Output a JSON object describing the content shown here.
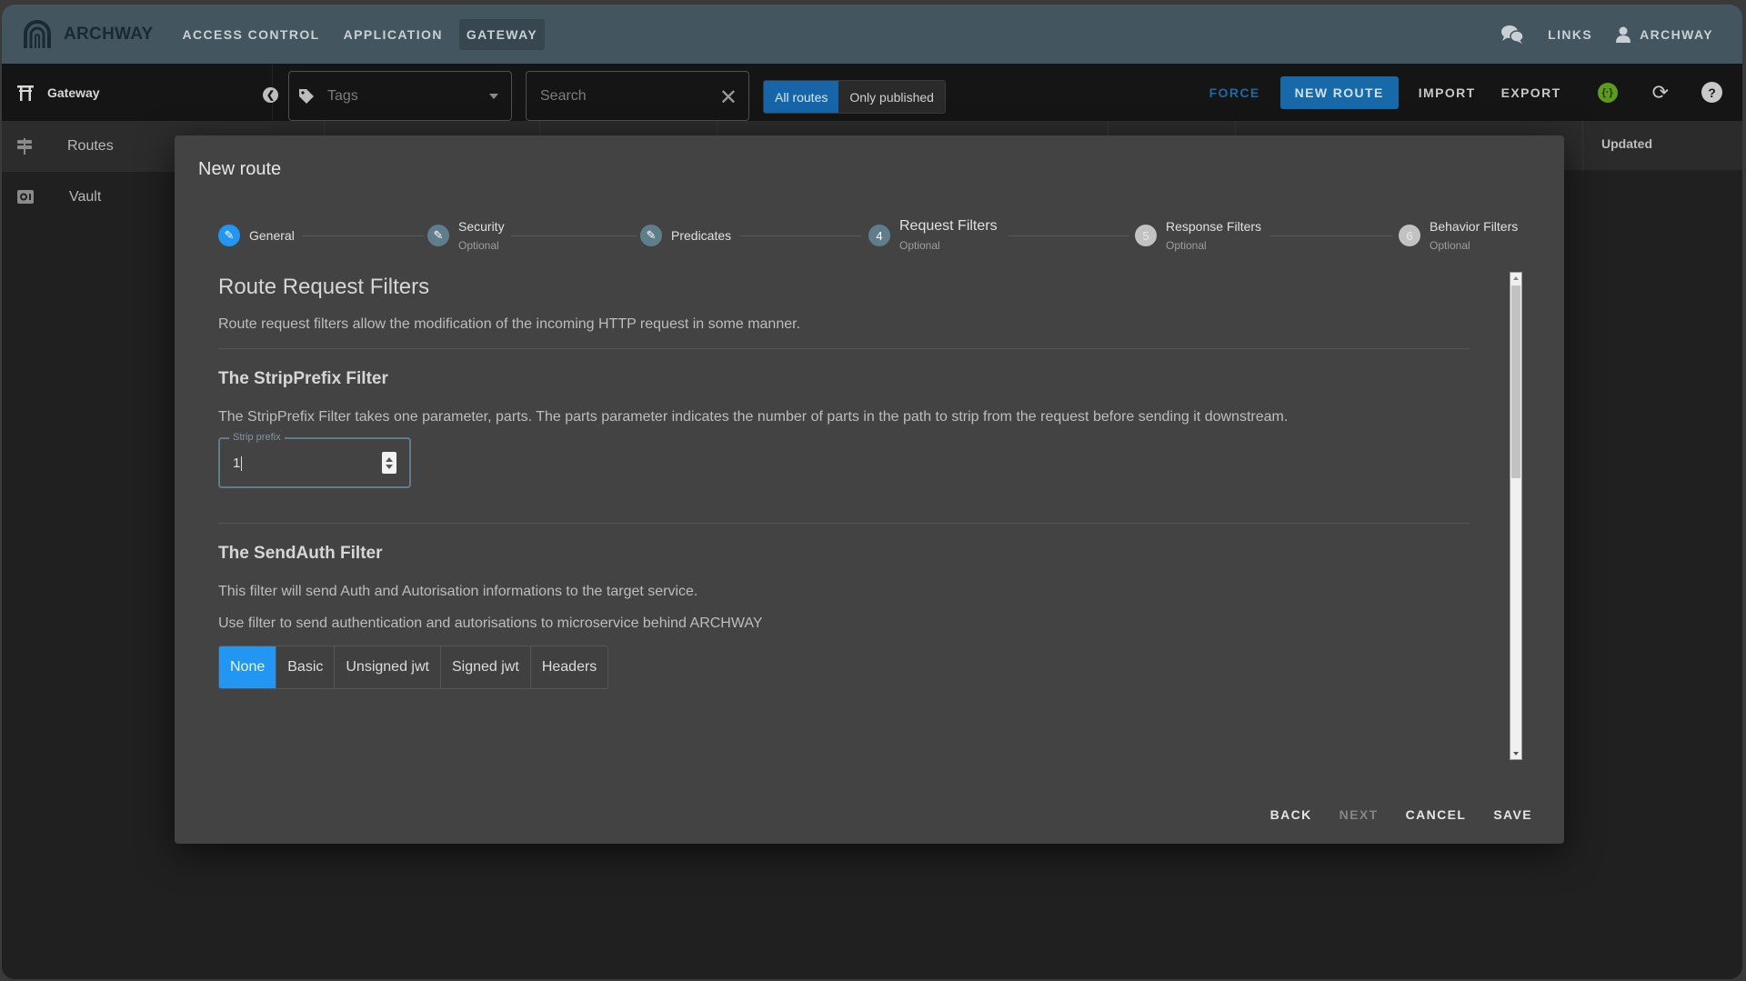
{
  "app": {
    "name": "ARCHWAY"
  },
  "topnav": {
    "items": [
      {
        "label": "ACCESS CONTROL",
        "active": false
      },
      {
        "label": "APPLICATION",
        "active": false
      },
      {
        "label": "GATEWAY",
        "active": true
      }
    ],
    "links_label": "LINKS",
    "user_label": "ARCHWAY"
  },
  "toolbar": {
    "section_label": "Gateway",
    "tags_placeholder": "Tags",
    "search_placeholder": "Search",
    "search_value": "",
    "filter_toggle": [
      {
        "label": "All routes",
        "active": true
      },
      {
        "label": "Only published",
        "active": false
      }
    ],
    "force_label": "FORCE",
    "new_route_label": "NEW ROUTE",
    "import_label": "IMPORT",
    "export_label": "EXPORT",
    "icons": {
      "api": "api-braces-icon",
      "refresh": "refresh-icon",
      "help": "help-icon"
    }
  },
  "sidebar": {
    "items": [
      {
        "label": "Routes",
        "icon": "signpost-icon",
        "active": true
      },
      {
        "label": "Vault",
        "icon": "vault-icon",
        "active": false
      }
    ]
  },
  "table": {
    "visible_header": "Updated"
  },
  "modal": {
    "title": "New route",
    "steps": [
      {
        "label": "General",
        "optional": "",
        "state": "done",
        "number": ""
      },
      {
        "label": "Security",
        "optional": "Optional",
        "state": "done",
        "number": ""
      },
      {
        "label": "Predicates",
        "optional": "",
        "state": "done",
        "number": ""
      },
      {
        "label": "Request Filters",
        "optional": "Optional",
        "state": "current",
        "number": "4"
      },
      {
        "label": "Response Filters",
        "optional": "Optional",
        "state": "todo",
        "number": "5"
      },
      {
        "label": "Behavior Filters",
        "optional": "Optional",
        "state": "todo",
        "number": "6"
      }
    ],
    "section_title": "Route Request Filters",
    "section_desc": "Route request filters allow the modification of the incoming HTTP request in some manner.",
    "strip_prefix": {
      "title": "The StripPrefix Filter",
      "desc": "The StripPrefix Filter takes one parameter, parts. The parts parameter indicates the number of parts in the path to strip from the request before sending it downstream.",
      "field_label": "Strip prefix",
      "field_value": "1"
    },
    "send_auth": {
      "title": "The SendAuth Filter",
      "desc1": "This filter will send Auth and Autorisation informations to the target service.",
      "desc2": "Use filter to send authentication and autorisations to microservice behind ARCHWAY",
      "options": [
        {
          "label": "None",
          "active": true
        },
        {
          "label": "Basic",
          "active": false
        },
        {
          "label": "Unsigned jwt",
          "active": false
        },
        {
          "label": "Signed jwt",
          "active": false
        },
        {
          "label": "Headers",
          "active": false
        }
      ]
    },
    "actions": {
      "back": "BACK",
      "next": "NEXT",
      "cancel": "CANCEL",
      "save": "SAVE"
    }
  }
}
